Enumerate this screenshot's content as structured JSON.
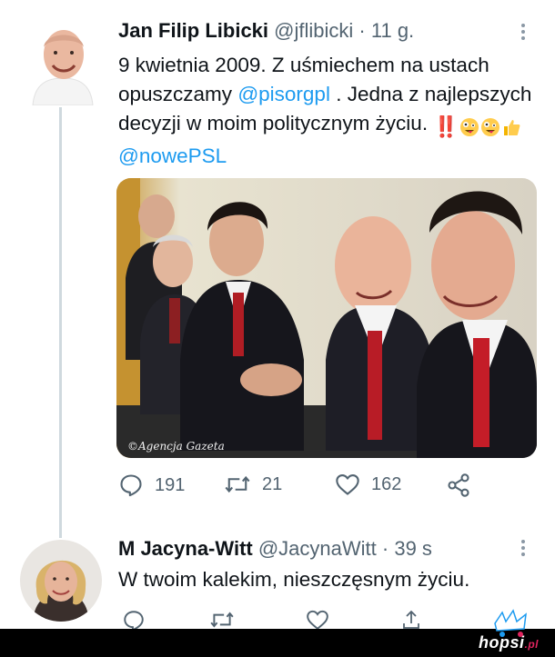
{
  "tweet": {
    "author_name": "Jan Filip Libicki",
    "author_handle": "@jflibicki",
    "separator": "·",
    "time": "11 g.",
    "text_lead": "9 kwietnia 2009. Z uśmiechem na ustach opuszczamy",
    "mention_1": "@pisorgpl",
    "text_mid": ". Jedna z najlepszych decyzji w moim politycznym życiu.",
    "bangs": "‼️",
    "mention_2": "@nowePSL",
    "photo_credit": "©Agencja Gazeta",
    "actions": {
      "replies": "191",
      "retweets": "21",
      "likes": "162"
    }
  },
  "reply": {
    "author_name": "M Jacyna-Witt",
    "author_handle": "@JacynaWitt",
    "separator": "·",
    "time": "39 s",
    "text": "W twoim kalekim, nieszczęsnym życiu."
  },
  "watermark": {
    "brand": "hopsi",
    "suffix": ".pl"
  },
  "icons": {
    "reply": "reply-icon",
    "retweet": "retweet-icon",
    "like": "heart-icon",
    "share": "share-icon",
    "more": "more-icon"
  },
  "colors": {
    "link": "#1d9bf0",
    "secondary_text": "#536471",
    "thread_line": "#cfd9de",
    "bar": "#000000"
  }
}
